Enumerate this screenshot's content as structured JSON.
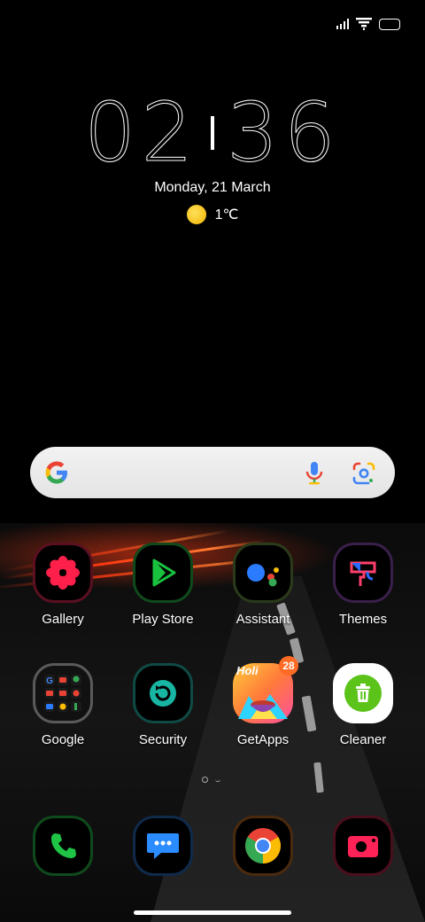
{
  "clock": {
    "hours": "02",
    "minutes": "36"
  },
  "date": "Monday, 21 March",
  "weather": {
    "temperature": "1℃",
    "icon": "sun-icon"
  },
  "search": {
    "logo": "google-g-logo",
    "mic_icon": "microphone-icon",
    "lens_icon": "google-lens-icon"
  },
  "apps_row1": [
    {
      "label": "Gallery",
      "icon": "flower-icon",
      "accent": "#ff1f4b"
    },
    {
      "label": "Play Store",
      "icon": "play-triangle-icon",
      "accent": "#18c23f"
    },
    {
      "label": "Assistant",
      "icon": "assistant-dots-icon",
      "accent": "#2b7bff"
    },
    {
      "label": "Themes",
      "icon": "paint-roller-icon",
      "accent": "#ff3f6b"
    }
  ],
  "apps_row2": [
    {
      "label": "Google",
      "icon": "google-folder-icon",
      "accent": "#9a9a9a"
    },
    {
      "label": "Security",
      "icon": "refresh-shield-icon",
      "accent": "#18b6a2"
    },
    {
      "label": "GetApps",
      "icon": "getapps-holi-icon",
      "accent": "#ff6a25",
      "badge": "28",
      "banner": "Holi"
    },
    {
      "label": "Cleaner",
      "icon": "trash-icon",
      "accent": "#5cc31a"
    }
  ],
  "dock": [
    {
      "name": "phone",
      "icon": "phone-icon",
      "accent": "#1fc446"
    },
    {
      "name": "messages",
      "icon": "message-bubble-icon",
      "accent": "#2b8cff"
    },
    {
      "name": "chrome",
      "icon": "chrome-icon",
      "accent": "#ea4335"
    },
    {
      "name": "camera",
      "icon": "camera-icon",
      "accent": "#ff2257"
    }
  ]
}
